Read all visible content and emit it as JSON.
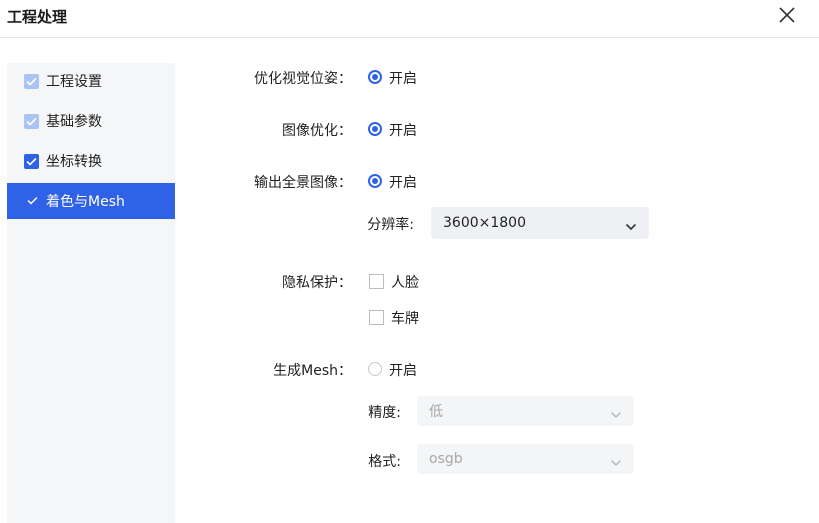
{
  "dialog": {
    "title": "工程处理",
    "close_icon": "close-icon"
  },
  "sidebar": {
    "items": [
      {
        "label": "工程设置",
        "state": "checked-light"
      },
      {
        "label": "基础参数",
        "state": "checked-light"
      },
      {
        "label": "坐标转换",
        "state": "checked"
      },
      {
        "label": "着色与Mesh",
        "state": "active"
      }
    ]
  },
  "form": {
    "view_opt": {
      "label": "优化视觉位姿：",
      "option": "开启",
      "checked": true
    },
    "image_opt": {
      "label": "图像优化：",
      "option": "开启",
      "checked": true
    },
    "panorama": {
      "label": "输出全景图像：",
      "option": "开启",
      "checked": true
    },
    "resolution": {
      "label": "分辨率:",
      "value": "3600×1800"
    },
    "privacy": {
      "label": "隐私保护：",
      "options": [
        "人脸",
        "车牌"
      ]
    },
    "mesh": {
      "label": "生成Mesh：",
      "option": "开启",
      "checked": false
    },
    "precision": {
      "label": "精度:",
      "value": "低"
    },
    "format": {
      "label": "格式:",
      "value": "osgb"
    }
  },
  "colors": {
    "accent": "#2f62e6",
    "accent_light": "#a9c3f2",
    "sidebar_bg": "#f5f6f8"
  }
}
